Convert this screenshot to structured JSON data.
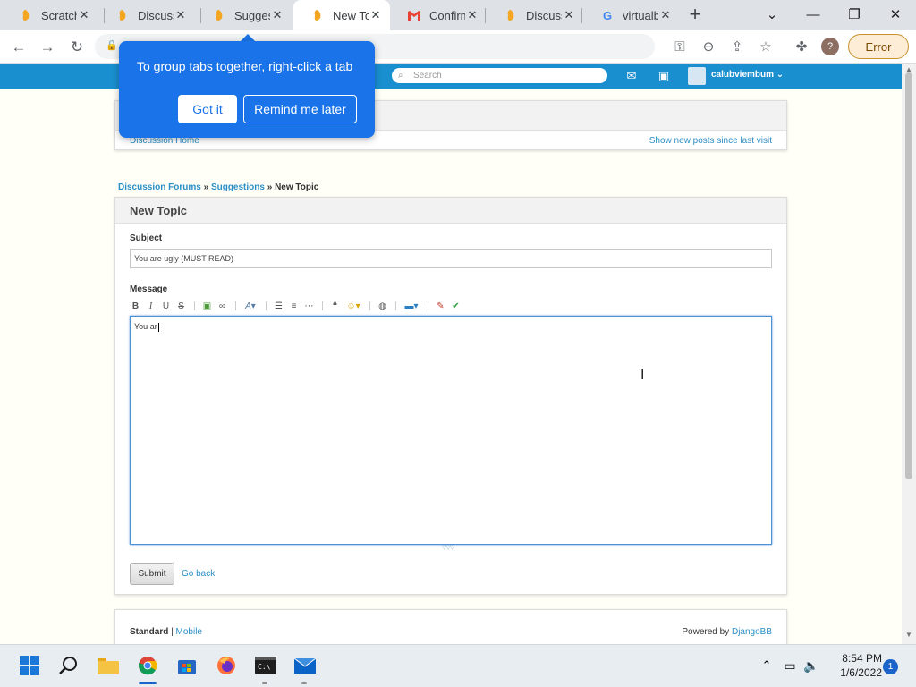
{
  "browser": {
    "tabs": [
      {
        "title": "Scratch",
        "icon": "scratch-icon"
      },
      {
        "title": "Discuss",
        "icon": "scratch-icon"
      },
      {
        "title": "Suggest",
        "icon": "scratch-icon"
      },
      {
        "title": "New Topi",
        "icon": "scratch-icon"
      },
      {
        "title": "Confirm",
        "icon": "gmail-icon"
      },
      {
        "title": "Discuss",
        "icon": "scratch-icon"
      },
      {
        "title": "virtualb",
        "icon": "google-icon"
      }
    ],
    "active_tab_index": 3,
    "error_label": "Error",
    "profile_initial": "?",
    "popup": {
      "text": "To group tabs together, right-click a tab",
      "got_it": "Got it",
      "remind": "Remind me later"
    }
  },
  "site": {
    "search_placeholder": "Search",
    "username": "calubviembum",
    "discussion_home": "Discussion Home",
    "show_new_posts": "Show new posts since last visit",
    "breadcrumb": {
      "forums": "Discussion Forums",
      "sep": "»",
      "suggestions": "Suggestions",
      "current": "New Topic"
    },
    "form": {
      "title": "New Topic",
      "subject_label": "Subject",
      "subject_value": "You are ugly (MUST READ)",
      "message_label": "Message",
      "message_value": "You ar",
      "submit": "Submit",
      "go_back": "Go back"
    },
    "footer": {
      "standard": "Standard",
      "sep": "|",
      "mobile": "Mobile",
      "powered_by": "Powered by",
      "djangobb": "DjangoBB"
    }
  },
  "taskbar": {
    "time": "8:54 PM",
    "date": "1/6/2022",
    "notifications": "1"
  },
  "colors": {
    "site_blue": "#1a8fcf",
    "popup_blue": "#1a73e8",
    "link_blue": "#2b8ec6"
  }
}
